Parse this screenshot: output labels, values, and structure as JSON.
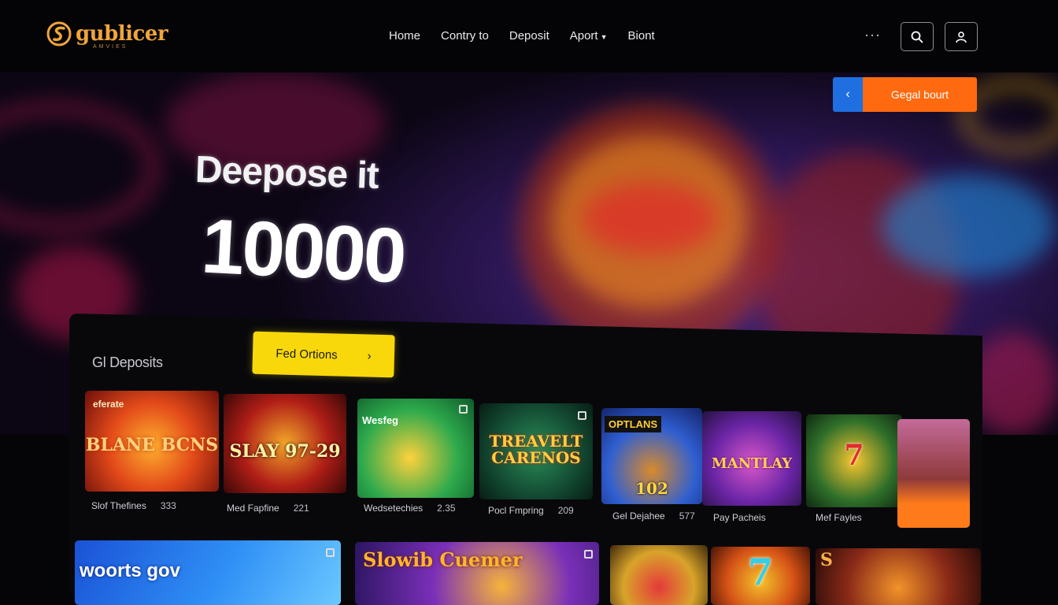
{
  "brand": {
    "name": "gublicer",
    "tagline": "AMVIES",
    "color": "#f1a53a"
  },
  "nav": {
    "items": [
      {
        "label": "Home"
      },
      {
        "label": "Contry to"
      },
      {
        "label": "Deposit"
      },
      {
        "label": "Aport",
        "has_dropdown": true
      },
      {
        "label": "Biont"
      }
    ],
    "more_label": "···",
    "icons": [
      "search-icon",
      "user-icon"
    ]
  },
  "hero": {
    "title": "Deepose it",
    "amount": "10000",
    "banner_label": "Gegal bourt",
    "banner_prev_icon": "chevron-left-icon",
    "banner_prev_glyph": "‹",
    "colors": {
      "banner_prev": "#1f6fe0",
      "banner": "#ff6a10"
    }
  },
  "games_section": {
    "title": "Gl Deposits",
    "cta_label": "Fed Ortions",
    "cta_chevron": "›",
    "cta_color": "#f8d80b"
  },
  "games_row1": [
    {
      "badge": "eferate",
      "art": "BLANE BCNS",
      "name": "Slof Thefines",
      "count": "333"
    },
    {
      "art": "SLAY 97-29",
      "name": "Med Fapfine",
      "count": "221"
    },
    {
      "badge": "Wesfeg",
      "art": "",
      "name": "Wedsetechies",
      "count": "2.35"
    },
    {
      "art": "TREAVELT CARENOS",
      "name": "Pocl Fmpring",
      "count": "209"
    },
    {
      "badge": "OPTLANS",
      "art": "102",
      "name": "Gel Dejahee",
      "count": "577"
    },
    {
      "art": "MANTLAY",
      "name": "Pay Pacheis",
      "count": ""
    },
    {
      "art": "7",
      "name": "Mef Fayles",
      "count": ""
    },
    {
      "art": "",
      "name": "",
      "count": ""
    }
  ],
  "games_row2": [
    {
      "art": "woorts gov"
    },
    {
      "art": "Slowib Cuemer"
    },
    {
      "art": ""
    },
    {
      "art": "7"
    },
    {
      "art": "S"
    }
  ]
}
